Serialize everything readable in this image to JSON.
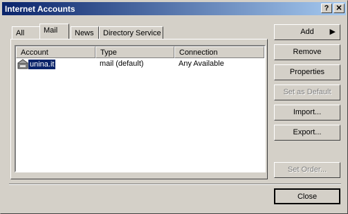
{
  "window": {
    "title": "Internet Accounts",
    "help_glyph": "?",
    "close_glyph": "✕"
  },
  "tabs": [
    {
      "label": "All"
    },
    {
      "label": "Mail"
    },
    {
      "label": "News"
    },
    {
      "label": "Directory Service"
    }
  ],
  "list": {
    "columns": [
      "Account",
      "Type",
      "Connection"
    ],
    "rows": [
      {
        "account": "unina.it",
        "type": "mail (default)",
        "connection": "Any Available"
      }
    ]
  },
  "buttons": {
    "add": "Add",
    "remove": "Remove",
    "properties": "Properties",
    "set_as_default": "Set as Default",
    "import": "Import...",
    "export": "Export...",
    "set_order": "Set Order...",
    "close": "Close"
  },
  "colors": {
    "titlebar_start": "#0a246a",
    "titlebar_end": "#a6caf0",
    "selection": "#0a246a",
    "face": "#d4d0c8"
  }
}
